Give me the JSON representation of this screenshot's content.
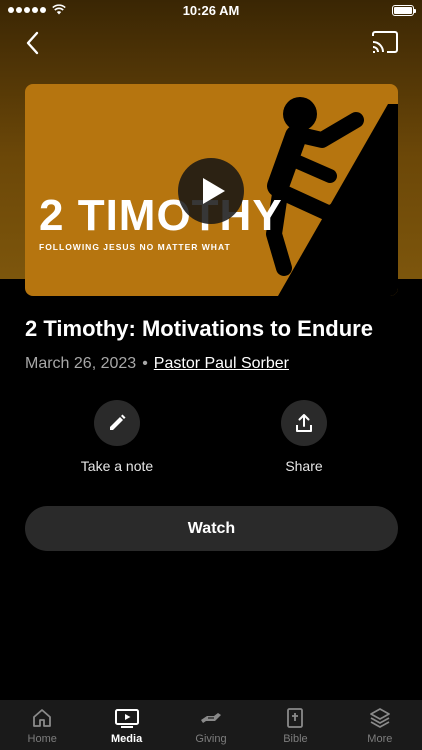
{
  "status_bar": {
    "time": "10:26 AM"
  },
  "sermon": {
    "thumb_title": "2 TIMOTHY",
    "thumb_subtitle": "FOLLOWING JESUS NO MATTER WHAT",
    "title": "2 Timothy: Motivations to Endure",
    "date": "March 26, 2023",
    "separator": "•",
    "author": "Pastor Paul Sorber"
  },
  "actions": {
    "note_label": "Take a note",
    "share_label": "Share"
  },
  "watch_label": "Watch",
  "tabs": [
    {
      "label": "Home",
      "icon": "home-icon"
    },
    {
      "label": "Media",
      "icon": "play-screen-icon",
      "active": true
    },
    {
      "label": "Giving",
      "icon": "giving-hands-icon"
    },
    {
      "label": "Bible",
      "icon": "bible-icon"
    },
    {
      "label": "More",
      "icon": "layers-icon"
    }
  ],
  "colors": {
    "thumbnail": "#b6750f",
    "hero_gradient_top": "#3a2604",
    "hero_gradient_bottom": "#7d560c",
    "button_bg": "#2a2a2a",
    "tabbar_bg": "#1a1a1a"
  }
}
